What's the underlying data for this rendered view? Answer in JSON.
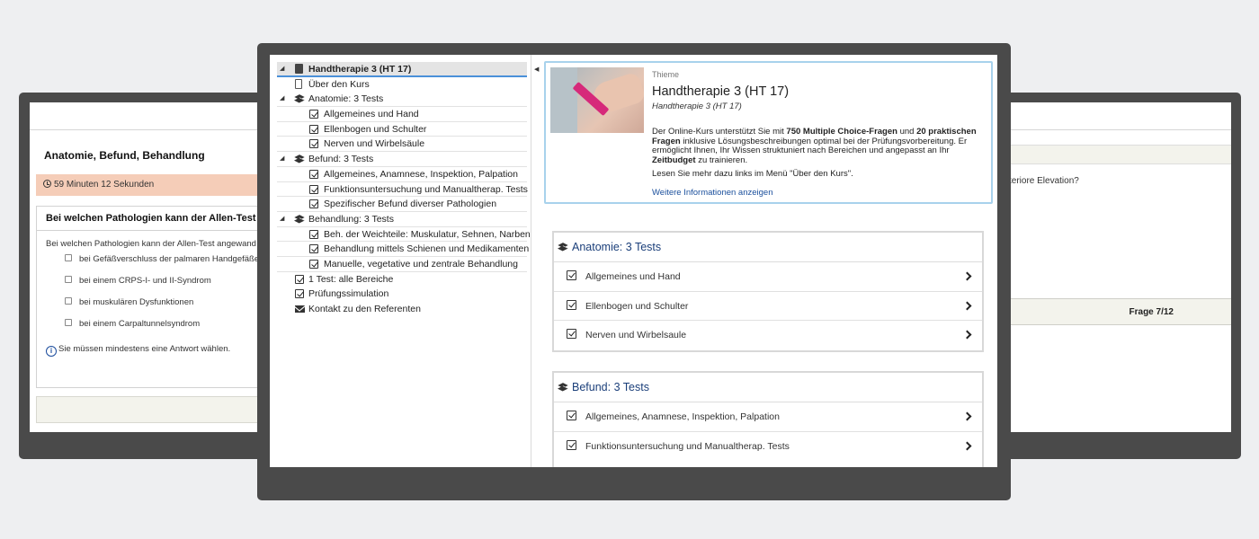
{
  "left_screen": {
    "title": "Anatomie, Befund, Behandlung",
    "timer": "59 Minuten 12 Sekunden",
    "question_heading": "Bei welchen Pathologien kann der Allen-Test ang",
    "question_text": "Bei welchen Pathologien kann der Allen-Test angewand",
    "options": [
      "bei Gefäßverschluss der palmaren Handgefäße",
      "bei einem CRPS-I- und II-Syndrom",
      "bei muskulären Dysfunktionen",
      "bei einem Carpaltunnelsyndrom"
    ],
    "hint": "Sie müssen mindestens eine Antwort wählen."
  },
  "right_screen": {
    "question_fragment": "teriore Elevation?",
    "page_indicator": "Frage 7/12"
  },
  "tree": {
    "root": "Handtherapie 3 (HT 17)",
    "items": [
      {
        "label": "Über den Kurs",
        "icon": "document-icon",
        "level": 0
      },
      {
        "label": "Anatomie: 3 Tests",
        "icon": "layers-icon",
        "level": 0,
        "expand": true
      },
      {
        "label": "Allgemeines und Hand",
        "icon": "checkbox-icon",
        "level": 1
      },
      {
        "label": "Ellenbogen und Schulter",
        "icon": "checkbox-icon",
        "level": 1
      },
      {
        "label": "Nerven und Wirbelsäule",
        "icon": "checkbox-icon",
        "level": 1
      },
      {
        "label": "Befund: 3 Tests",
        "icon": "layers-icon",
        "level": 0,
        "expand": true
      },
      {
        "label": "Allgemeines, Anamnese, Inspektion, Palpation",
        "icon": "checkbox-icon",
        "level": 1
      },
      {
        "label": "Funktionsuntersuchung und Manualtherap. Tests",
        "icon": "checkbox-icon",
        "level": 1
      },
      {
        "label": "Spezifischer Befund diverser Pathologien",
        "icon": "checkbox-icon",
        "level": 1
      },
      {
        "label": "Behandlung: 3 Tests",
        "icon": "layers-icon",
        "level": 0,
        "expand": true
      },
      {
        "label": "Beh. der Weichteile: Muskulatur, Sehnen, Narben",
        "icon": "checkbox-icon",
        "level": 1
      },
      {
        "label": "Behandlung mittels Schienen und Medikamenten",
        "icon": "checkbox-icon",
        "level": 1
      },
      {
        "label": "Manuelle, vegetative und zentrale Behandlung",
        "icon": "checkbox-icon",
        "level": 1
      },
      {
        "label": "1 Test: alle Bereiche",
        "icon": "checkbox-icon",
        "level": 0
      },
      {
        "label": "Prüfungssimulation",
        "icon": "checkbox-icon",
        "level": 0
      },
      {
        "label": "Kontakt zu den Referenten",
        "icon": "envelope-icon",
        "level": 0
      }
    ]
  },
  "info_card": {
    "publisher": "Thieme",
    "title": "Handtherapie 3 (HT 17)",
    "subtitle": "Handtherapie 3 (HT 17)",
    "desc_1": "Der Online-Kurs unterstützt Sie mit ",
    "desc_b1": "750 Multiple Choice-Fragen",
    "desc_2": " und ",
    "desc_b2": "20 praktischen Fragen",
    "desc_3": " inklusive Lösungsbeschreibungen optimal bei der Prüfungsvorbereitung. Er ermöglicht Ihnen, Ihr Wissen struktuniert nach Bereichen und angepasst an Ihr ",
    "desc_b3": "Zeitbudget",
    "desc_4": " zu trainieren.",
    "more": "Lesen Sie mehr dazu links im Menü \"Über den Kurs\".",
    "link": "Weitere Informationen anzeigen"
  },
  "panels": [
    {
      "title": "Anatomie: 3 Tests",
      "items": [
        "Allgemeines und Hand",
        "Ellenbogen und Schulter",
        "Nerven und Wirbelsaule"
      ]
    },
    {
      "title": "Befund: 3 Tests",
      "items": [
        "Allgemeines, Anamnese, Inspektion, Palpation",
        "Funktionsuntersuchung und Manualtherap. Tests"
      ]
    }
  ],
  "colors": {
    "accent_blue": "#4a90d9",
    "link_blue": "#1a4f9c",
    "timer_bg": "#f5cdb8",
    "tape_pink": "#d6297a"
  }
}
